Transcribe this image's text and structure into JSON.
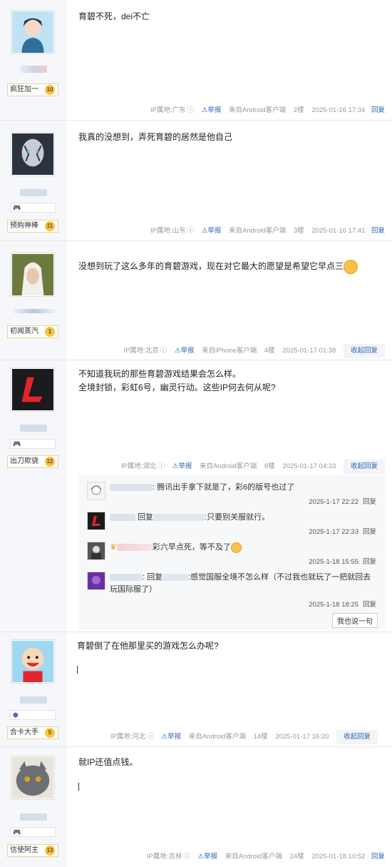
{
  "posts": [
    {
      "content": [
        "育碧不死，dei不亡"
      ],
      "level_title": "疯狂加一",
      "level": "10",
      "ip": "IP属地:广东",
      "report": "举报",
      "client": "来自Android客户端",
      "floor": "2楼",
      "time": "2025-01-16 17:34",
      "reply": "回复"
    },
    {
      "content": [
        "我真的没想到，弄死育碧的居然是他自己"
      ],
      "level_title": "预购神棒",
      "level": "11",
      "ip": "IP属地:山东",
      "report": "举报",
      "client": "来自Android客户端",
      "floor": "3楼",
      "time": "2025-01-16 17:41",
      "reply": "回复"
    },
    {
      "content": [
        "没想到玩了这么多年的育碧游戏，现在对它最大的愿望是希望它早点三"
      ],
      "level_title": "初闻蒸汽",
      "level": "1",
      "ip": "IP属地:北京",
      "report": "举报",
      "client": "来自iPhone客户端",
      "floor": "4楼",
      "time": "2025-01-17 01:38",
      "reply": "收起回复"
    },
    {
      "content": [
        "不知道我玩的那些育碧游戏结果会怎么样。",
        "全境封锁，彩虹6号，幽灵行动。这些IP何去何从呢?"
      ],
      "level_title": "出刀欺骁",
      "level": "12",
      "ip": "IP属地:湖北",
      "report": "举报",
      "client": "来自Android客户端",
      "floor": "8楼",
      "time": "2025-01-17 04:33",
      "reply": "收起回复"
    },
    {
      "content": [
        "育碧倒了在他那里买的游戏怎么办呢?"
      ],
      "level_title": "合卡大手",
      "level": "5",
      "ip": "IP属地:河北",
      "report": "举报",
      "client": "来自Android客户端",
      "floor": "14楼",
      "time": "2025-01-17 16:20",
      "reply": "收起回复"
    },
    {
      "content": [
        "就IP还值点钱。"
      ],
      "level_title": "信使阿主",
      "level": "13",
      "ip": "IP属地:吉林",
      "report": "举报",
      "client": "来自Android客户端",
      "floor": "24楼",
      "time": "2025-01-18 10:52",
      "reply": "回复"
    }
  ],
  "sub_replies": [
    {
      "text": ": 腾讯出手拿下就是了，彩6的版号也过了",
      "time": "2025-1-17 22:22",
      "reply": "回复"
    },
    {
      "prefix": "回复",
      "text": ":只要别关服就行。",
      "time": "2025-1-17 22:33",
      "reply": "回复"
    },
    {
      "text": "彩六早点死，等不及了",
      "time": "2025-1-18 15:55",
      "reply": "回复"
    },
    {
      "prefix": ": 回复",
      "text": ":感觉国服全境不怎么样（不过我也就玩了一把就回去玩国际服了）",
      "time": "2025-1-18 18:25",
      "reply": "回复"
    }
  ],
  "say_button": "我也说一句",
  "icons": {
    "report": "warning-triangle-icon",
    "help": "question-circle-icon"
  }
}
